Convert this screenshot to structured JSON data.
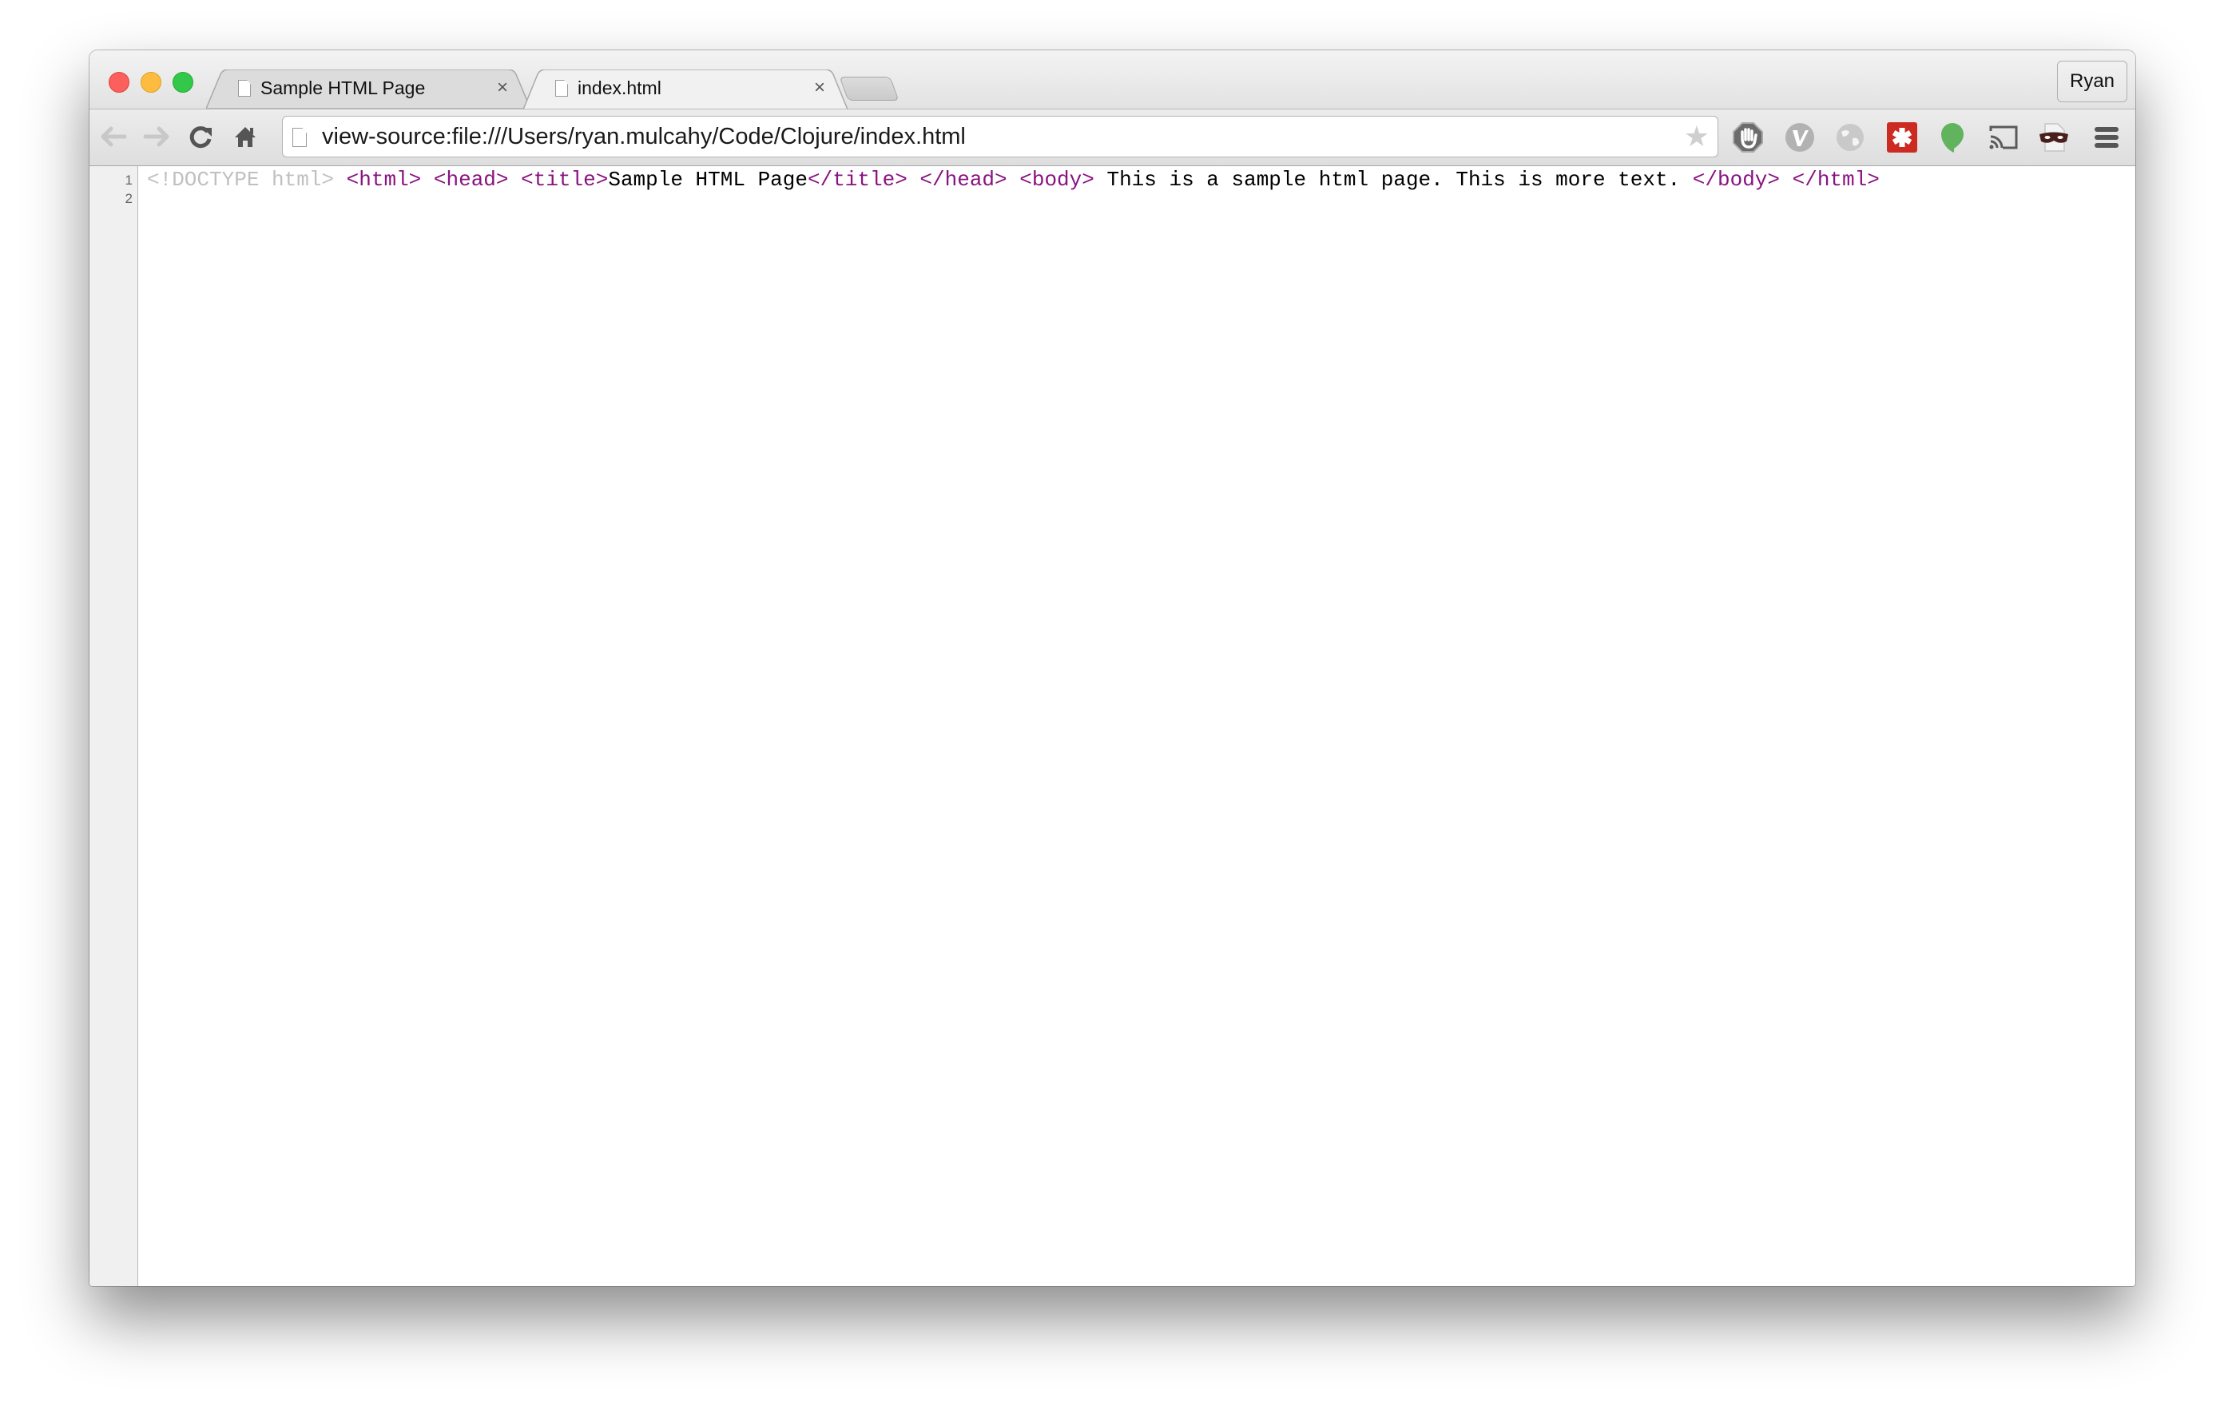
{
  "browser": {
    "profile_name": "Ryan",
    "tabs": [
      {
        "title": "Sample HTML Page",
        "active": false,
        "icon": "file-icon"
      },
      {
        "title": "index.html",
        "active": true,
        "icon": "file-icon"
      }
    ],
    "close_glyph": "×",
    "address_bar": {
      "url": "view-source:file:///Users/ryan.mulcahy/Code/Clojure/index.html"
    },
    "toolbar_icons": [
      "back-icon",
      "forward-icon",
      "reload-icon",
      "home-icon",
      "bookmark-star-icon"
    ],
    "extensions": [
      "adblock-icon",
      "vimium-icon",
      "globe-icon",
      "lastpass-icon",
      "hangouts-icon",
      "cast-icon",
      "incognito-mask-icon",
      "chrome-menu-icon"
    ]
  },
  "source_view": {
    "line_numbers": [
      "1",
      "2"
    ],
    "line1_tokens": [
      {
        "type": "doctype",
        "text": "<!DOCTYPE html>"
      },
      {
        "type": "text",
        "text": " "
      },
      {
        "type": "tag",
        "text": "<html>"
      },
      {
        "type": "text",
        "text": " "
      },
      {
        "type": "tag",
        "text": "<head>"
      },
      {
        "type": "text",
        "text": " "
      },
      {
        "type": "tag",
        "text": "<title>"
      },
      {
        "type": "text",
        "text": "Sample HTML Page"
      },
      {
        "type": "tag",
        "text": "</title>"
      },
      {
        "type": "text",
        "text": " "
      },
      {
        "type": "tag",
        "text": "</head>"
      },
      {
        "type": "text",
        "text": " "
      },
      {
        "type": "tag",
        "text": "<body>"
      },
      {
        "type": "text",
        "text": " This is a sample html page. This is more text. "
      },
      {
        "type": "tag",
        "text": "</body>"
      },
      {
        "type": "text",
        "text": " "
      },
      {
        "type": "tag",
        "text": "</html>"
      }
    ],
    "colors": {
      "tag": "#881280",
      "doctype": "#c0c0c0",
      "text": "#000000"
    }
  }
}
